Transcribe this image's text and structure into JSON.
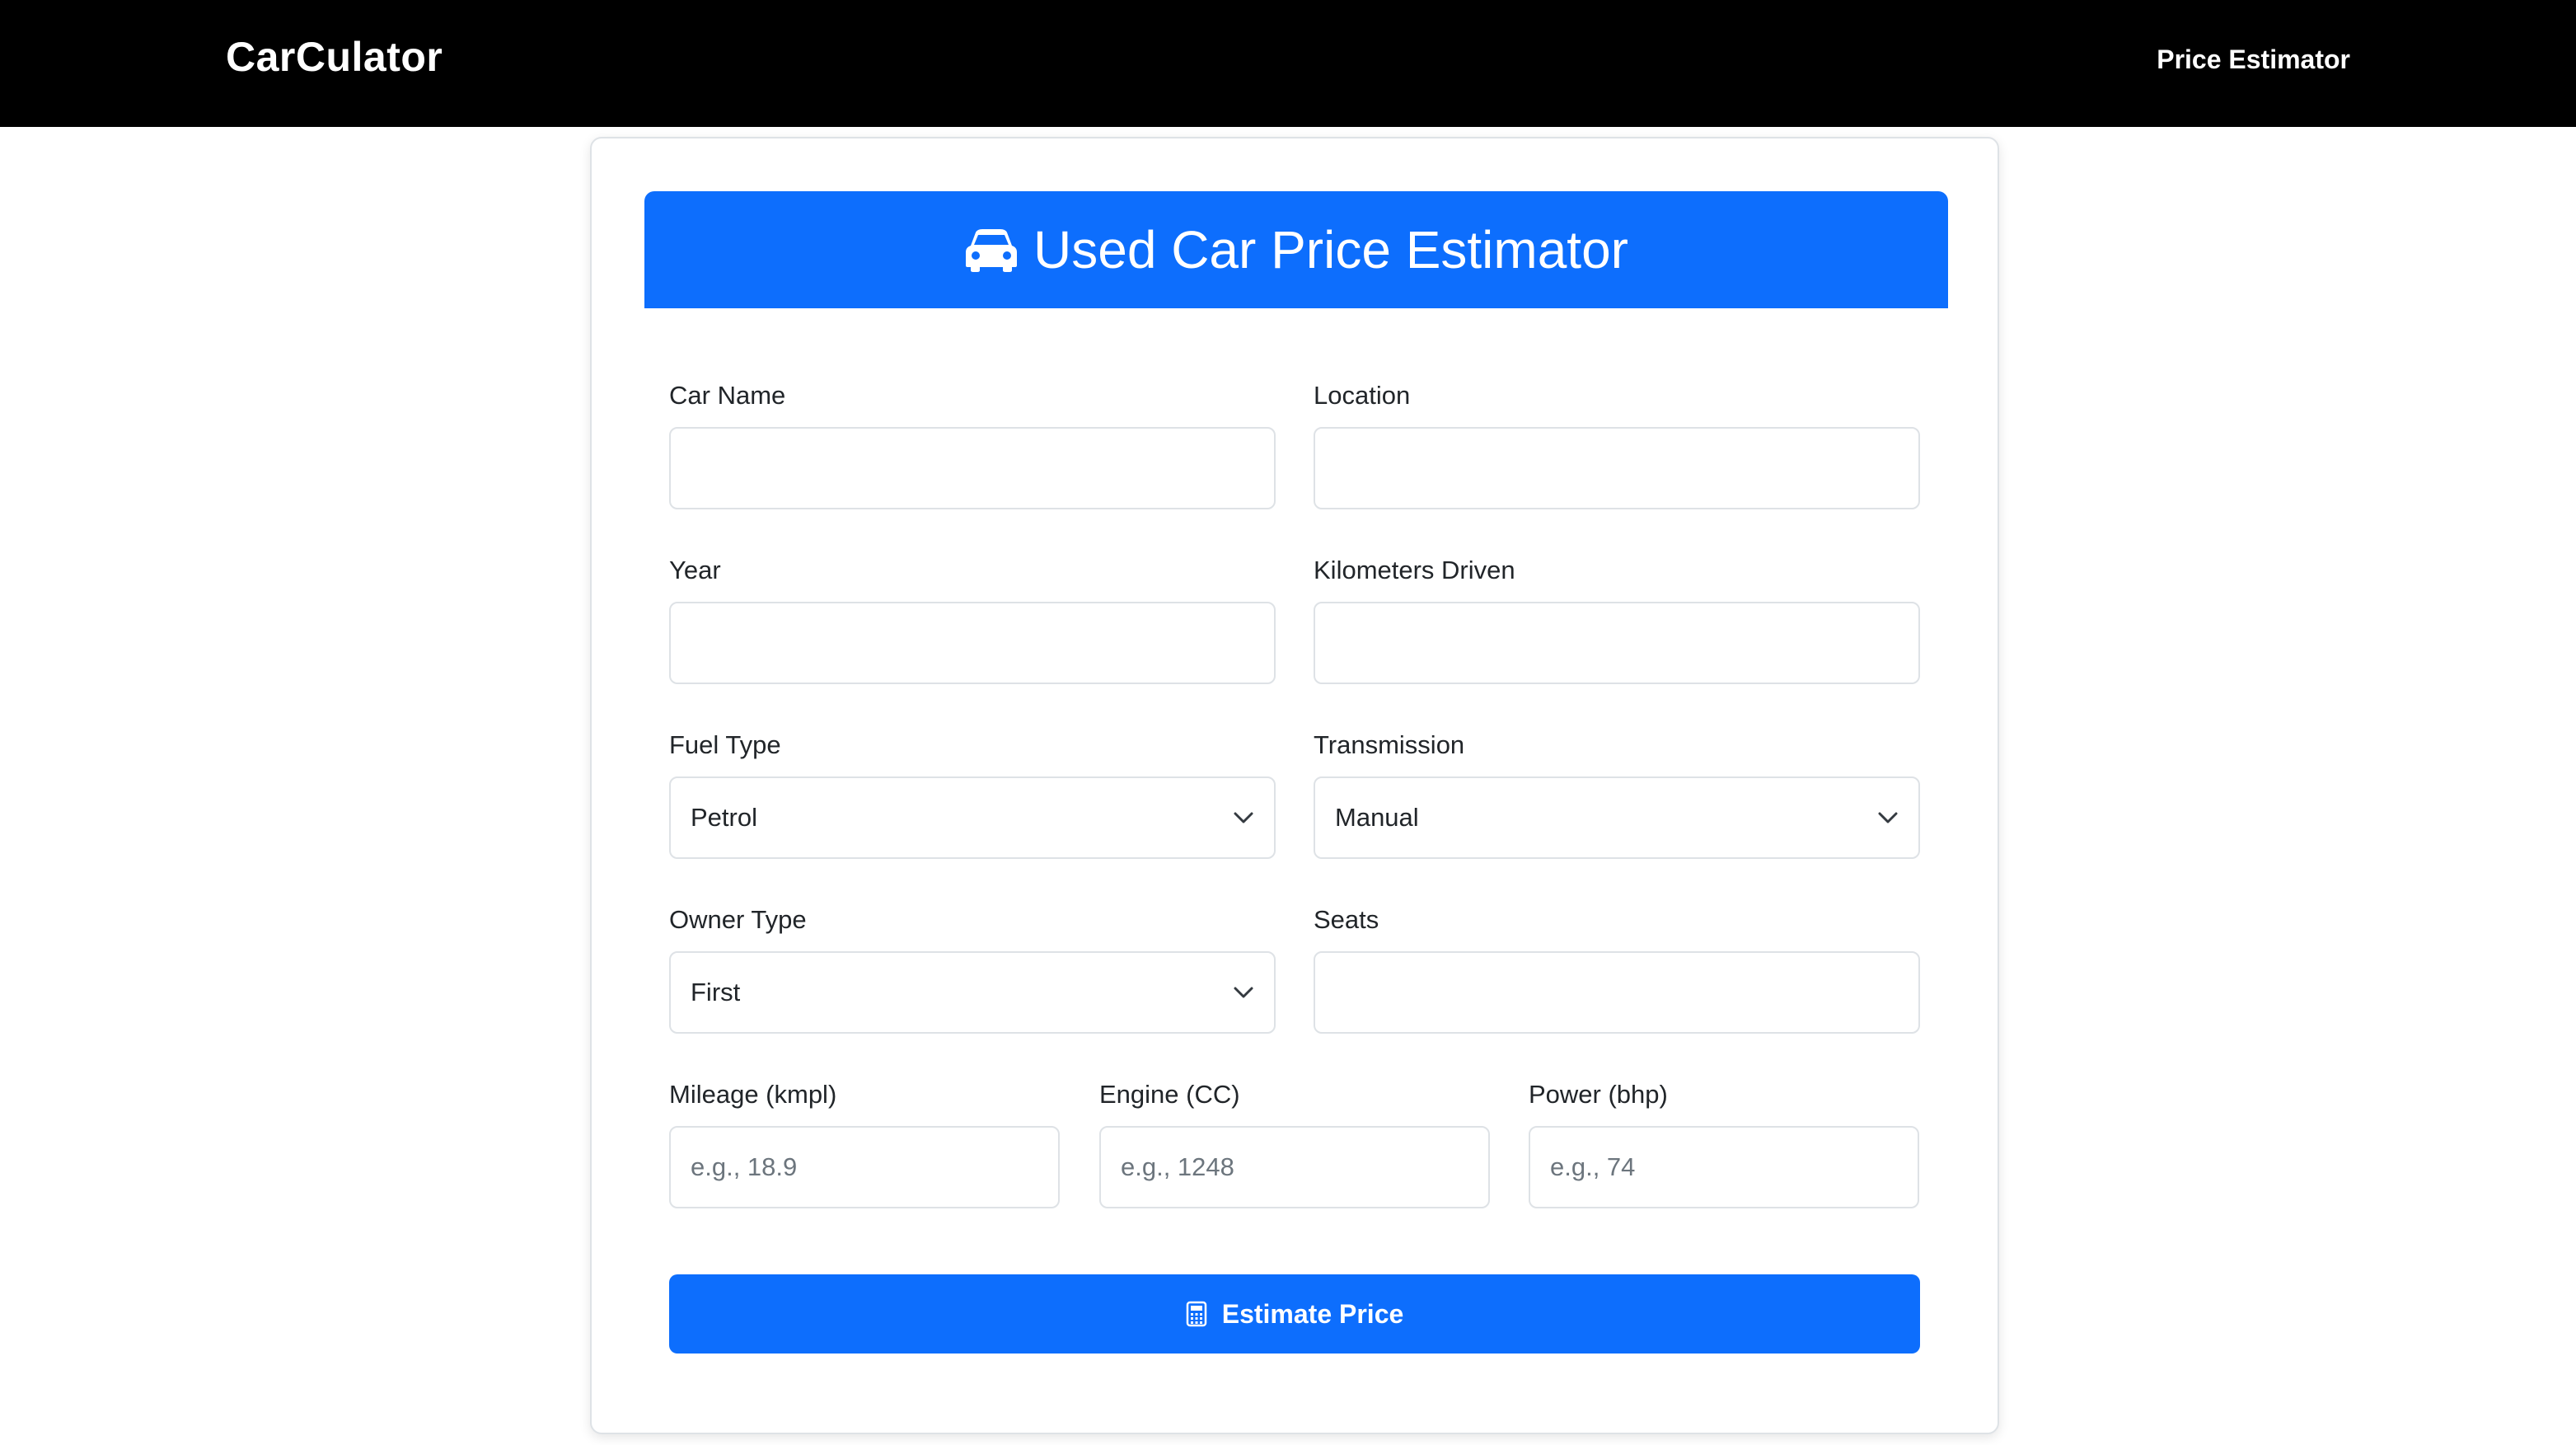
{
  "navbar": {
    "brand": "CarCulator",
    "link": "Price Estimator"
  },
  "form": {
    "title": "Used Car Price Estimator",
    "title_icon": "car-icon",
    "fields": {
      "car_name": {
        "label": "Car Name",
        "value": ""
      },
      "location": {
        "label": "Location",
        "value": ""
      },
      "year": {
        "label": "Year",
        "value": ""
      },
      "kilometers": {
        "label": "Kilometers Driven",
        "value": ""
      },
      "fuel_type": {
        "label": "Fuel Type",
        "value": "Petrol"
      },
      "transmission": {
        "label": "Transmission",
        "value": "Manual"
      },
      "owner_type": {
        "label": "Owner Type",
        "value": "First"
      },
      "seats": {
        "label": "Seats",
        "value": ""
      },
      "mileage": {
        "label": "Mileage (kmpl)",
        "placeholder": "e.g., 18.9"
      },
      "engine": {
        "label": "Engine (CC)",
        "placeholder": "e.g., 1248"
      },
      "power": {
        "label": "Power (bhp)",
        "placeholder": "e.g., 74"
      }
    },
    "submit": {
      "label": "Estimate Price",
      "icon": "calculator-icon"
    }
  },
  "colors": {
    "navbar_bg": "#000000",
    "primary": "#0d6efd",
    "border": "#dee2e6"
  }
}
